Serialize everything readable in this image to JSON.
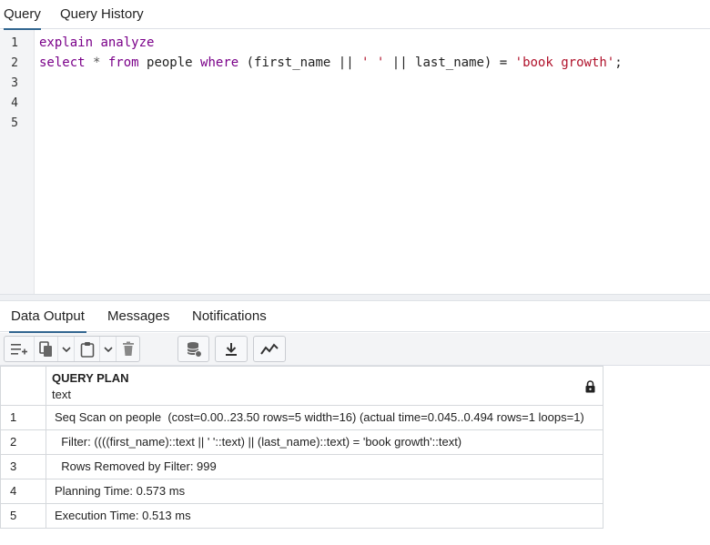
{
  "top_tabs": [
    {
      "label": "Query"
    },
    {
      "label": "Query History"
    }
  ],
  "editor": {
    "line_numbers": [
      "1",
      "2",
      "3",
      "4",
      "5"
    ],
    "line1": {
      "kw1": "explain",
      "sp": " ",
      "kw2": "analyze"
    },
    "line2": {
      "t1": "select",
      "t2": " * ",
      "t3": "from",
      "t4": " people ",
      "t5": "where",
      "t6": " (first_name || ",
      "t7": "' '",
      "t8": " || last_name) = ",
      "t9": "'book growth'",
      "t10": ";"
    }
  },
  "bottom_tabs": [
    {
      "label": "Data Output"
    },
    {
      "label": "Messages"
    },
    {
      "label": "Notifications"
    }
  ],
  "toolbar": {
    "icons": [
      "add-row-icon",
      "copy-icon",
      "paste-icon",
      "delete-icon",
      "save-data-icon",
      "download-icon",
      "graph-icon"
    ]
  },
  "grid": {
    "column": {
      "title": "QUERY PLAN",
      "type": "text"
    },
    "rows": [
      {
        "num": "1",
        "value": "Seq Scan on people  (cost=0.00..23.50 rows=5 width=16) (actual time=0.045..0.494 rows=1 loops=1)"
      },
      {
        "num": "2",
        "value": "  Filter: ((((first_name)::text || ' '::text) || (last_name)::text) = 'book growth'::text)"
      },
      {
        "num": "3",
        "value": "  Rows Removed by Filter: 999"
      },
      {
        "num": "4",
        "value": "Planning Time: 0.573 ms"
      },
      {
        "num": "5",
        "value": "Execution Time: 0.513 ms"
      }
    ]
  },
  "colors": {
    "accent": "#326690",
    "keyword": "#7a0089",
    "string": "#b0122b"
  }
}
